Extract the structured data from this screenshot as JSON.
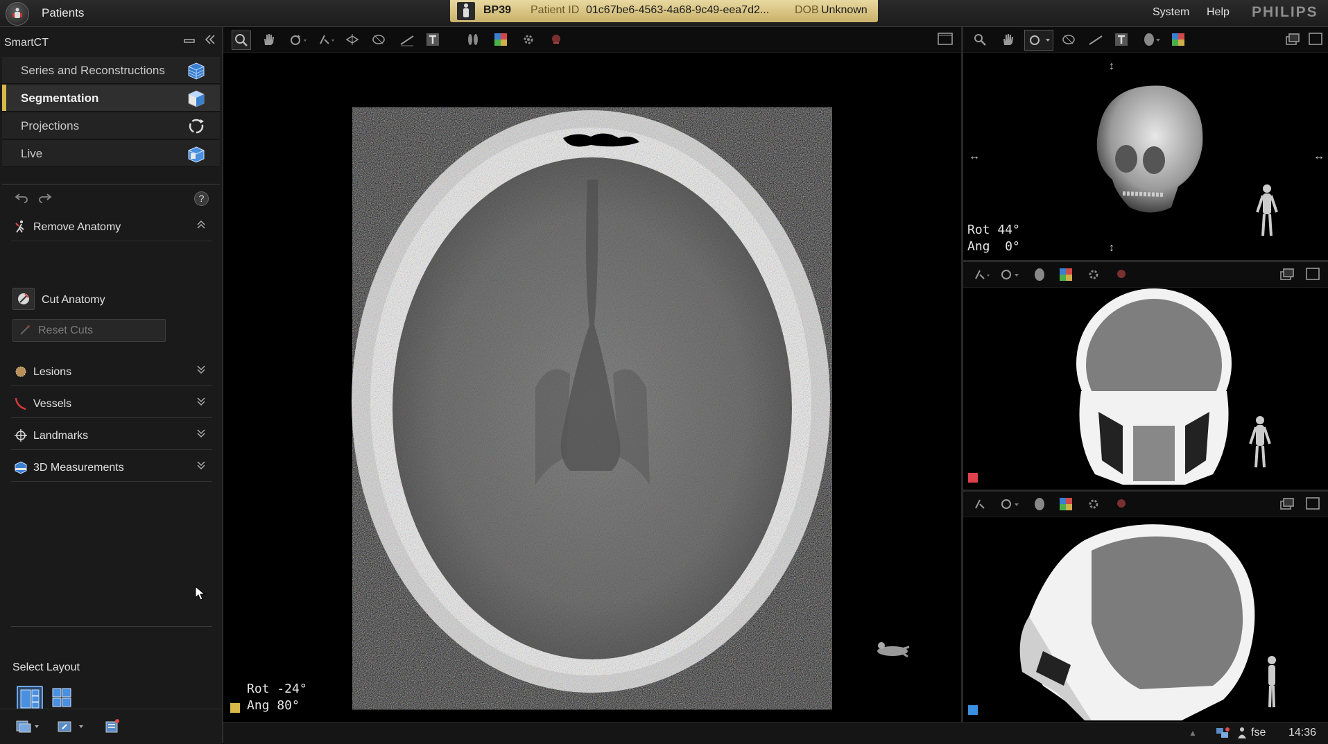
{
  "topbar": {
    "patients_label": "Patients",
    "patient_name": "BP39",
    "patient_id_label": "Patient ID",
    "patient_id_value": "01c67be6-4563-4a68-9c49-eea7d2...",
    "dob_label": "DOB",
    "dob_value": "Unknown",
    "nav": [
      "System",
      "Help"
    ],
    "brand": "PHILIPS"
  },
  "leftpanel": {
    "title": "SmartCT",
    "nav": [
      {
        "label": "Series and Reconstructions",
        "icon": "cube-stack-icon",
        "active": false
      },
      {
        "label": "Segmentation",
        "icon": "cube-icon",
        "active": true
      },
      {
        "label": "Projections",
        "icon": "rotate-icon",
        "active": false
      },
      {
        "label": "Live",
        "icon": "box-icon",
        "active": false
      }
    ],
    "help_glyph": "?",
    "remove_anatomy": {
      "label": "Remove Anatomy",
      "cut_anatomy": "Cut Anatomy",
      "reset_cuts": "Reset Cuts"
    },
    "sections": [
      {
        "label": "Lesions",
        "icon": "lesion-icon"
      },
      {
        "label": "Vessels",
        "icon": "vessel-icon"
      },
      {
        "label": "Landmarks",
        "icon": "landmark-icon"
      },
      {
        "label": "3D Measurements",
        "icon": "measurement-icon"
      }
    ],
    "select_layout": "Select Layout"
  },
  "main_viewport": {
    "rot": "Rot -24°",
    "ang": "Ang 80°",
    "marker_color": "#d8b848"
  },
  "side_viewports": {
    "top": {
      "rot": "Rot 44°",
      "ang": "Ang  0°"
    },
    "middle": {
      "marker_color": "#e0404a"
    },
    "bottom": {
      "marker_color": "#3a8fe0"
    }
  },
  "statusbar": {
    "user": "fse",
    "time": "14:36"
  },
  "colors": {
    "accent": "#d8b848",
    "banner": "#e0cf8e"
  }
}
